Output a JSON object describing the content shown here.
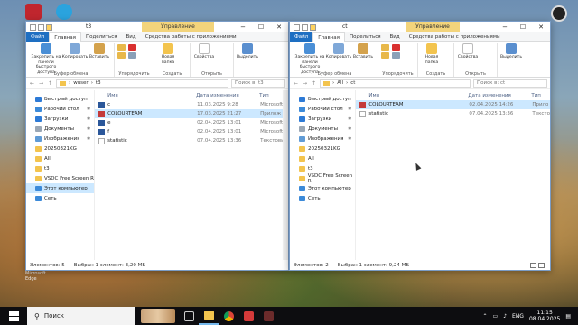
{
  "windows": [
    {
      "manage_label": "Управление",
      "title": "t3",
      "tabs": {
        "file": "Файл",
        "home": "Главная",
        "share": "Поделиться",
        "view": "Вид",
        "tools": "Средства работы с приложениями"
      },
      "ribbon": {
        "pin": "Закрепить на панели быстрого доступа",
        "copy": "Копировать",
        "paste": "Вставить",
        "new_folder": "Новая папка",
        "properties": "Свойства",
        "select": "Выделить",
        "clipboard_group": "Буфер обмена",
        "organize_group": "Упорядочить",
        "create_group": "Создать",
        "open_group": "Открыть"
      },
      "address": {
        "back": "←",
        "fwd": "→",
        "up": "↑",
        "path": [
          "wuser",
          "t3"
        ],
        "search_placeholder": "Поиск в: t3"
      },
      "columns": {
        "name": "Имя",
        "date": "Дата изменения",
        "type": "Тип"
      },
      "files": [
        {
          "name": "c",
          "date": "11.03.2025 9:28",
          "type": "Microsoft",
          "selected": false
        },
        {
          "name": "COLOURTEAM",
          "date": "17.03.2025 21:27",
          "type": "Прилож",
          "selected": true
        },
        {
          "name": "e",
          "date": "02.04.2025 13:01",
          "type": "Microsoft",
          "selected": false
        },
        {
          "name": "f",
          "date": "02.04.2025 13:01",
          "type": "Microsoft",
          "selected": false
        },
        {
          "name": "statistic",
          "date": "07.04.2025 13:36",
          "type": "Текстовый",
          "selected": false
        }
      ],
      "status": {
        "count": "Элементов: 5",
        "selection": "Выбран 1 элемент: 3,20 МБ"
      }
    },
    {
      "manage_label": "Управление",
      "title": "ct",
      "tabs": {
        "file": "Файл",
        "home": "Главная",
        "share": "Поделиться",
        "view": "Вид",
        "tools": "Средства работы с приложениями"
      },
      "ribbon": {
        "pin": "Закрепить на панели быстрого доступа",
        "copy": "Копировать",
        "paste": "Вставить",
        "new_folder": "Новая папка",
        "properties": "Свойства",
        "select": "Выделить",
        "clipboard_group": "Буфер обмена",
        "organize_group": "Упорядочить",
        "create_group": "Создать",
        "open_group": "Открыть"
      },
      "address": {
        "back": "←",
        "fwd": "→",
        "up": "↑",
        "path": [
          "All",
          "ct"
        ],
        "search_placeholder": "Поиск в: ct"
      },
      "columns": {
        "name": "Имя",
        "date": "Дата изменения",
        "type": "Тип"
      },
      "files": [
        {
          "name": "COLOURTEAM",
          "date": "02.04.2025 14:26",
          "type": "Прило",
          "selected": true
        },
        {
          "name": "statistic",
          "date": "07.04.2025 13:36",
          "type": "Тексто",
          "selected": false
        }
      ],
      "status": {
        "count": "Элементов: 2",
        "selection": "Выбран 1 элемент: 9,24 МБ"
      }
    }
  ],
  "nav_pane": [
    {
      "label": "Быстрый доступ",
      "icon": "star-icon",
      "pinned": false
    },
    {
      "label": "Рабочий стол",
      "icon": "desktop-icon",
      "pinned": true
    },
    {
      "label": "Загрузки",
      "icon": "download-icon",
      "pinned": true
    },
    {
      "label": "Документы",
      "icon": "documents-icon",
      "pinned": true
    },
    {
      "label": "Изображения",
      "icon": "pictures-icon",
      "pinned": true
    },
    {
      "label": "20250321KG",
      "icon": "folder-icon",
      "pinned": false
    },
    {
      "label": "All",
      "icon": "folder-icon",
      "pinned": false
    },
    {
      "label": "t3",
      "icon": "folder-icon",
      "pinned": false
    },
    {
      "label": "VSDC Free Screen R",
      "icon": "folder-icon",
      "pinned": false
    },
    {
      "label": "Этот компьютер",
      "icon": "computer-icon",
      "pinned": false
    },
    {
      "label": "Сеть",
      "icon": "network-icon",
      "pinned": false
    }
  ],
  "taskbar": {
    "search_label": "Поиск",
    "lang": "ENG",
    "time": "11:15",
    "date": "08.04.2025"
  },
  "desktop_labels": {
    "edge": "Microsoft Edge"
  }
}
